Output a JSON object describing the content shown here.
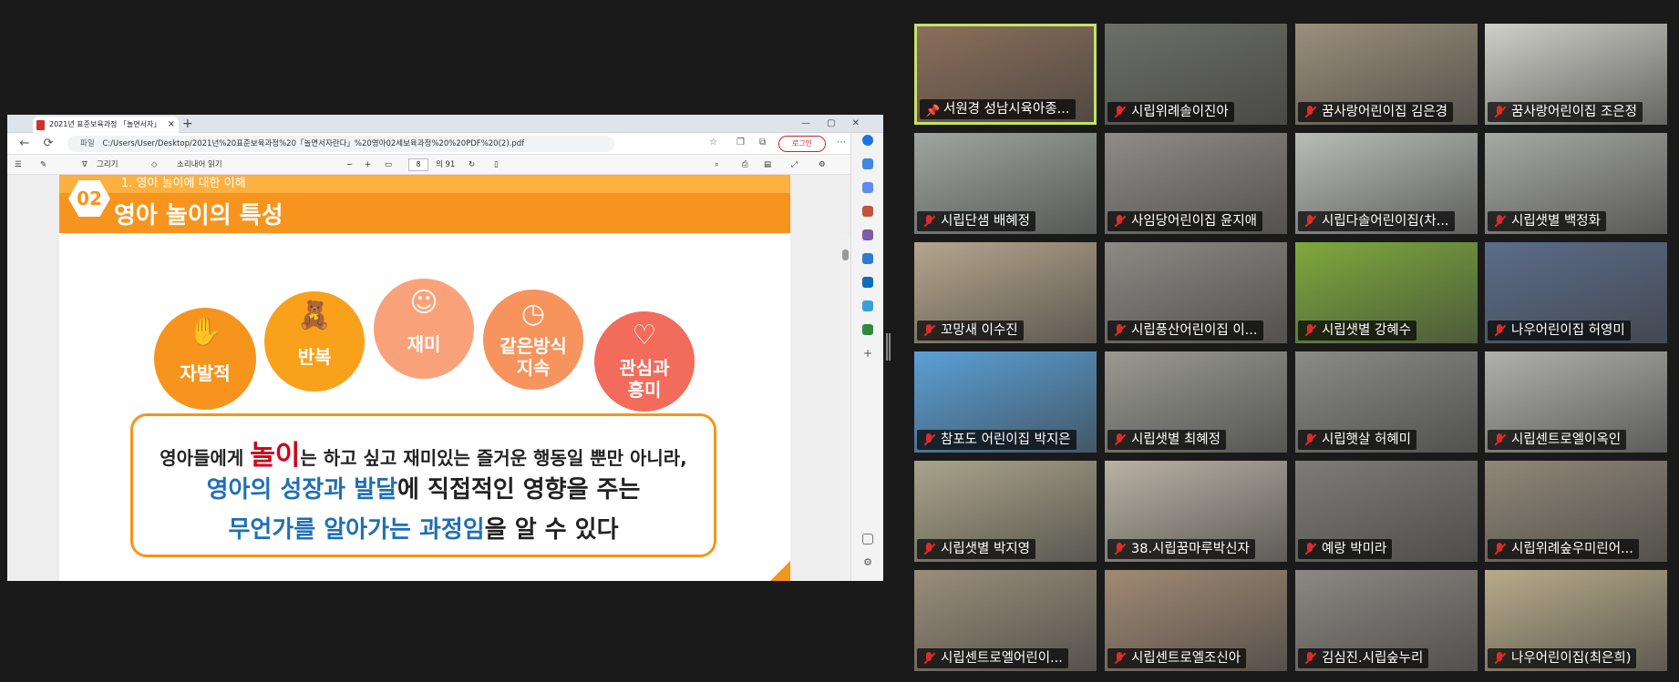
{
  "browser": {
    "tab_title": "2021년 표준보육과정 「놀면서자」",
    "url_label": "파일",
    "url": "C:/Users/User/Desktop/2021년%20표준보육과정%20「놀면서자란다」%20영아02세보육과정%20%20PDF%20(2).pdf",
    "login_label": "로그인",
    "new_tab": "+",
    "close_tab": "×"
  },
  "pdf_toolbar": {
    "draw_label": "그리기",
    "read_aloud_label": "소리내어 읽기",
    "minus": "−",
    "plus": "+",
    "page_current": "8",
    "page_total": "의 91"
  },
  "slide": {
    "number": "02",
    "subtitle": "1. 영아 놀이에 대한 이해",
    "title": "영아 놀이의 특성",
    "circles": [
      {
        "label1": "자발적",
        "label2": "",
        "color": "#f7941d",
        "icon": "raised-hands-icon",
        "glyph": "✋"
      },
      {
        "label1": "반복",
        "label2": "",
        "color": "#f9a11b",
        "icon": "teddy-bear-icon",
        "glyph": "🧸"
      },
      {
        "label1": "재미",
        "label2": "",
        "color": "#f9a27a",
        "icon": "happy-faces-icon",
        "glyph": "☺"
      },
      {
        "label1": "같은방식",
        "label2": "지속",
        "color": "#f7935c",
        "icon": "clock-icon",
        "glyph": "◷"
      },
      {
        "label1": "관심과",
        "label2": "흥미",
        "color": "#f26b5b",
        "icon": "heart-search-icon",
        "glyph": "♡"
      }
    ],
    "box_line1_pre": "영아들에게 ",
    "box_line1_red": "놀이",
    "box_line1_post": "는 하고 싶고 재미있는 즐거운 행동일 뿐만 아니라,",
    "box_line2_blue": "영아의 성장과 발달",
    "box_line2_post": "에 직접적인 영향을 주는",
    "box_line3_blue": "무언가를 알아가는 과정임",
    "box_line3_post": "을 알 수 있다"
  },
  "participants": [
    {
      "name": "서원경 성남시육아종...",
      "bg": "#8a6f5a",
      "active": true
    },
    {
      "name": "시립위례솔이진아",
      "bg": "#6d6f68"
    },
    {
      "name": "꿈사랑어린이집 김은경",
      "bg": "#9a8f7a"
    },
    {
      "name": "꿈사랑어린이집 조은정",
      "bg": "#cfd0c8"
    },
    {
      "name": "시립단샘 배혜정",
      "bg": "#9fa5a0"
    },
    {
      "name": "사임당어린이집 윤지애",
      "bg": "#8f8c88"
    },
    {
      "name": "시립다솔어린이집(차...",
      "bg": "#b9bcb8"
    },
    {
      "name": "시립샛별 백정화",
      "bg": "#a7a9a4"
    },
    {
      "name": "꼬망새 이수진",
      "bg": "#b5a58c"
    },
    {
      "name": "시립풍산어린이집 이...",
      "bg": "#8d8a84"
    },
    {
      "name": "시립샛별 강혜수",
      "bg": "#7daa3c"
    },
    {
      "name": "나우어린이집 허영미",
      "bg": "#5b6d8a"
    },
    {
      "name": "참포도 어린이집 박지은",
      "bg": "#5aa0d6"
    },
    {
      "name": "시립샛별 최혜정",
      "bg": "#9a9a92"
    },
    {
      "name": "시립햇살 허혜미",
      "bg": "#8a8a86"
    },
    {
      "name": "시립센트로엘이옥인",
      "bg": "#b0b0ac"
    },
    {
      "name": "시립샛별 박지영",
      "bg": "#a9a48a"
    },
    {
      "name": "38.시립꿈마루박신자",
      "bg": "#b8b2a4"
    },
    {
      "name": "예랑 박미라",
      "bg": "#7d7c78"
    },
    {
      "name": "시립위례숲우미린어...",
      "bg": "#8f8878"
    },
    {
      "name": "시립센트로엘어린이...",
      "bg": "#9a8e7a"
    },
    {
      "name": "시립센트로엘조신아",
      "bg": "#a08a74"
    },
    {
      "name": "김심진.시립숲누리",
      "bg": "#8c8882"
    },
    {
      "name": "나우어린이집(최은희)",
      "bg": "#b8ab8a"
    }
  ]
}
